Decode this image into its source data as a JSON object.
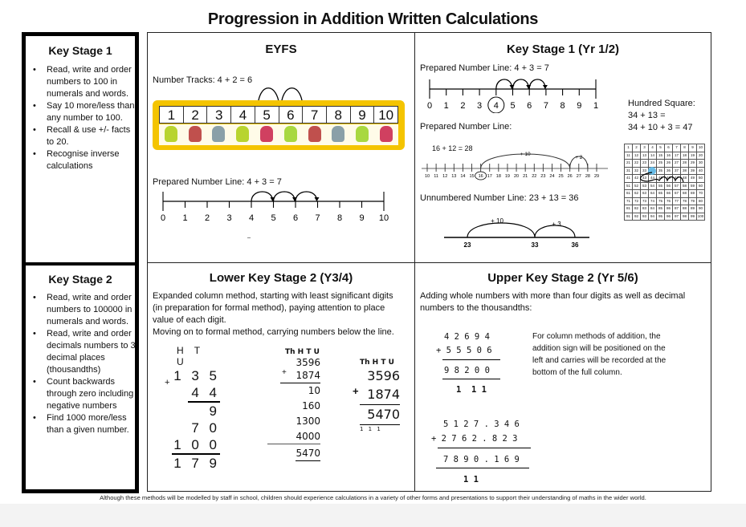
{
  "document": {
    "title": "Progression in Addition Written Calculations",
    "footer": "Although these methods will be modelled by staff in school, children should experience calculations in a variety of other forms and presentations to support their understanding of maths in the wider world."
  },
  "key_stage_1": {
    "heading": "Key Stage 1",
    "bullets": [
      "Read, write and order numbers to 100 in numerals and words.",
      "Say 10 more/less than any number to 100.",
      "Recall & use +/- facts to 20.",
      "Recognise inverse calculations"
    ]
  },
  "key_stage_2": {
    "heading": "Key Stage 2",
    "bullets": [
      "Read, write and order numbers to 100000 in numerals and words.",
      "Read, write and order decimals numbers to 3 decimal places (thousandths)",
      "Count backwards through zero including negative numbers",
      "Find 1000 more/less than a given number."
    ]
  },
  "eyfs": {
    "heading": "EYFS",
    "number_tracks_label": "Number Tracks: 4 + 2 = 6",
    "track_numbers": [
      "1",
      "2",
      "3",
      "4",
      "5",
      "6",
      "7",
      "8",
      "9",
      "10"
    ],
    "monster_colors": [
      "#b8d430",
      "#c0504d",
      "#8aa0a8",
      "#b8d430",
      "#d04060",
      "#a8d840",
      "#c0504d",
      "#8aa0a8",
      "#a8d840",
      "#d04060"
    ],
    "prepared_line_label": "Prepared Number Line: 4 + 3 = 7",
    "line_numbers": [
      "0",
      "1",
      "2",
      "3",
      "4",
      "5",
      "6",
      "7",
      "8",
      "9",
      "10"
    ]
  },
  "ks1_yr12": {
    "heading": "Key Stage 1 (Yr 1/2)",
    "prepared_line_label": "Prepared Number Line: 4 + 3 = 7",
    "line_numbers": [
      "0",
      "1",
      "2",
      "3",
      "4",
      "5",
      "6",
      "7",
      "8",
      "9",
      "1"
    ],
    "prepared_line_label_2": "Prepared Number Line:",
    "equation_16_12": "16 + 12 = 28",
    "line2_numbers": [
      "10",
      "11",
      "12",
      "13",
      "14",
      "15",
      "16",
      "17",
      "18",
      "19",
      "20",
      "21",
      "22",
      "23",
      "24",
      "25",
      "26",
      "27",
      "28",
      "29"
    ],
    "jump_10": "+ 10",
    "jump_2": "+ 2",
    "unnumbered_label": "Unnumbered Number Line: 23 + 13 = 36",
    "unnumbered_points": [
      "23",
      "33",
      "36"
    ],
    "unnumbered_jump_10": "+ 10",
    "unnumbered_jump_3": "+ 3",
    "hundred_square_label": "Hundred Square:",
    "hundred_square_eq1": "34 + 13 =",
    "hundred_square_eq2": "34 + 10 + 3 = 47",
    "highlight_color": "#5bb8e8"
  },
  "lower_ks2": {
    "heading": "Lower Key Stage 2 (Y3/4)",
    "description": [
      "Expanded column method, starting with least significant digits",
      "(in preparation for formal method), paying attention to place",
      "value of each digit.",
      "Moving on to formal method, carrying numbers below the line."
    ],
    "expanded_small": {
      "header": "H T U",
      "a": "1 3 5",
      "b": "4 4",
      "plus": "+",
      "partials": [
        "9",
        "7 0",
        "1 0 0"
      ],
      "total": "1 7 9"
    },
    "expanded_large": {
      "header": "Th H T U",
      "a": "3596",
      "b": "1874",
      "plus": "+",
      "partials": [
        "10",
        "160",
        "1300",
        "4000"
      ],
      "total": "5470"
    },
    "formal": {
      "header": "Th H T U",
      "a": "3596",
      "b": "1874",
      "plus": "+",
      "total": "5470",
      "carries": "1 1 1"
    }
  },
  "upper_ks2": {
    "heading": "Upper Key Stage 2 (Yr 5/6)",
    "description": [
      "Adding whole numbers with more than four digits as well as decimal",
      "numbers to the thousandths:"
    ],
    "note": [
      "For column methods of addition, the",
      "addition sign will be positioned on the",
      "left and carries will be recorded at the",
      "bottom of the full column."
    ],
    "whole": {
      "a": "4 2 6 9 4",
      "b": "5 5 5 0 6",
      "plus": "+",
      "total": "9 8 2 0 0",
      "carries": "1  1 1"
    },
    "decimal": {
      "a": "5 1 2 7 . 3 4 6",
      "b": "2 7 6 2 . 8 2 3",
      "plus": "+",
      "total": "7 8 9 0 . 1 6 9",
      "carries": "1 1"
    }
  }
}
